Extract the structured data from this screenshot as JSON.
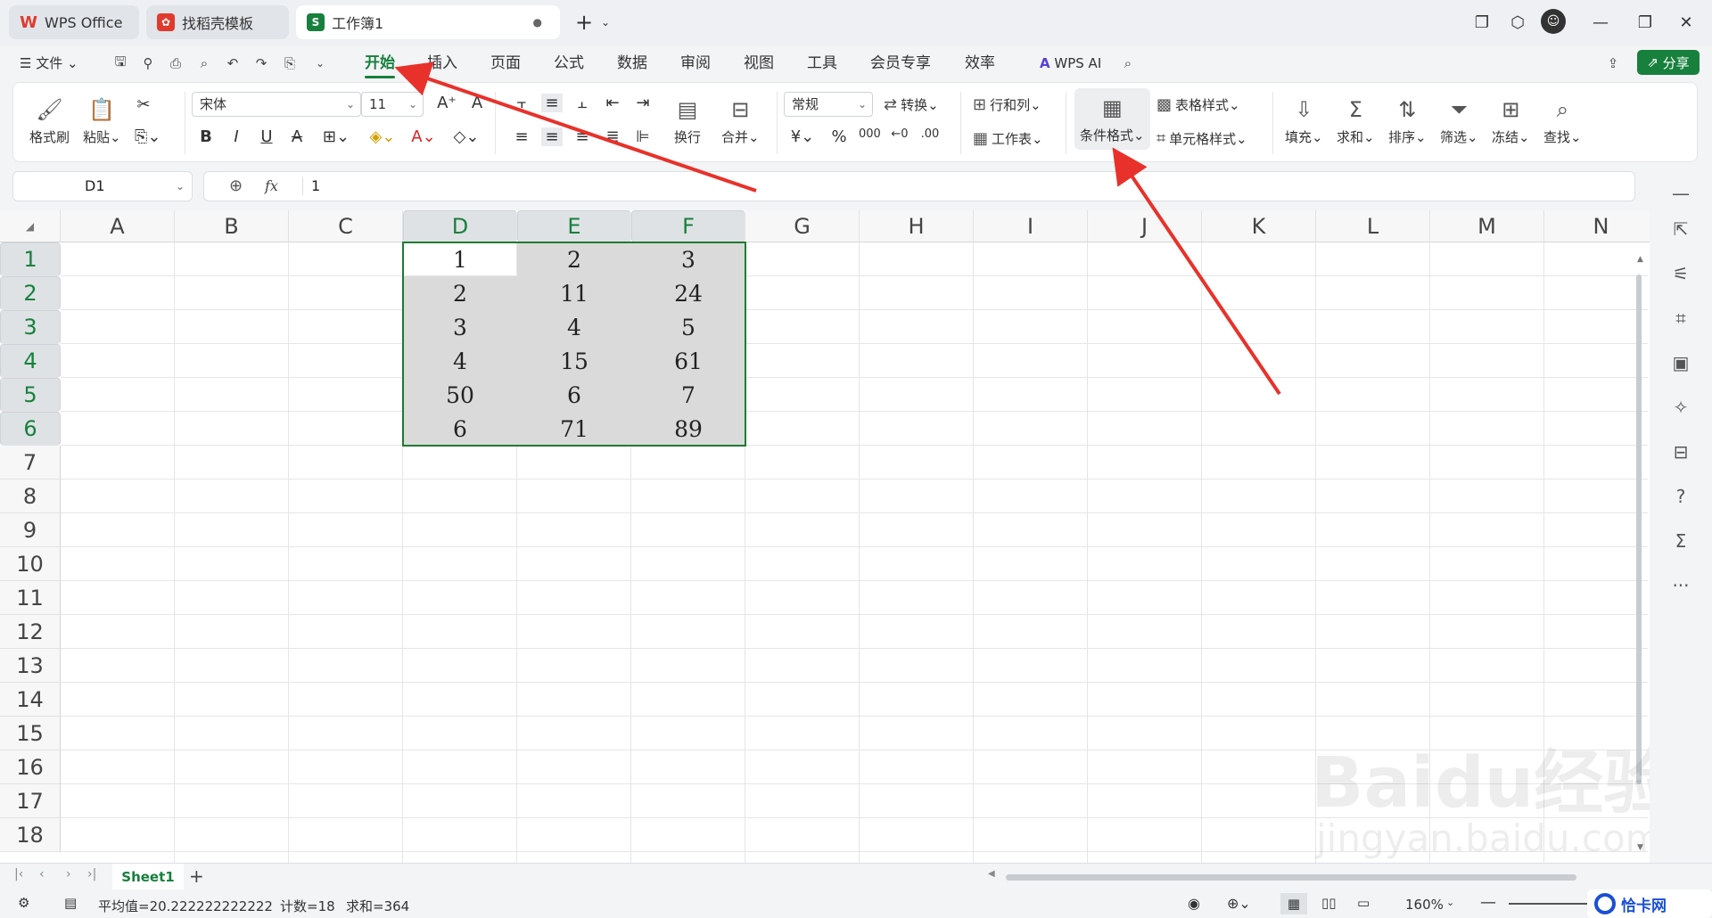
{
  "tabs": [
    {
      "label": "WPS Office",
      "icon": "wps-logo-icon"
    },
    {
      "label": "找稻壳模板",
      "icon": "docer-icon"
    },
    {
      "label": "工作簿1",
      "icon": "sheet-icon"
    }
  ],
  "menu": [
    "文件",
    "开始",
    "插入",
    "页面",
    "公式",
    "数据",
    "审阅",
    "视图",
    "工具",
    "会员专享",
    "效率",
    "WPS AI"
  ],
  "share_label": "分享",
  "ribbon": {
    "format_painter": "格式刷",
    "paste": "粘贴",
    "font_name": "宋体",
    "font_size": "11",
    "wrap": "换行",
    "merge": "合并",
    "number_format": "常规",
    "convert": "转换",
    "rows_cols": "行和列",
    "worksheet": "工作表",
    "conditional_format": "条件格式",
    "table_style": "表格样式",
    "cell_style": "单元格样式",
    "fill": "填充",
    "sum": "求和",
    "sort": "排序",
    "filter": "筛选",
    "freeze": "冻结",
    "find": "查找"
  },
  "name_box": "D1",
  "fx_label": "fx",
  "formula_value": "1",
  "columns": [
    "A",
    "B",
    "C",
    "D",
    "E",
    "F",
    "G",
    "H",
    "I",
    "J",
    "K",
    "L",
    "M",
    "N"
  ],
  "rows": [
    "1",
    "2",
    "3",
    "4",
    "5",
    "6",
    "7",
    "8",
    "9",
    "10",
    "11",
    "12",
    "13",
    "14",
    "15",
    "16",
    "17",
    "18"
  ],
  "cells": [
    [
      "1",
      "2",
      "3"
    ],
    [
      "2",
      "11",
      "24"
    ],
    [
      "3",
      "4",
      "5"
    ],
    [
      "4",
      "15",
      "61"
    ],
    [
      "50",
      "6",
      "7"
    ],
    [
      "6",
      "71",
      "89"
    ]
  ],
  "sheet_tab": "Sheet1",
  "status": {
    "average": "平均值=20.222222222222",
    "count": "计数=18",
    "sum": "求和=364",
    "zoom": "160%"
  },
  "watermark": {
    "baidu": "Baidu经验",
    "url": "jingyan.baidu.com",
    "site": "恰卡网"
  },
  "colors": {
    "accent": "#17803d",
    "arrow": "#e8312a",
    "selection": "#1f7a31"
  }
}
